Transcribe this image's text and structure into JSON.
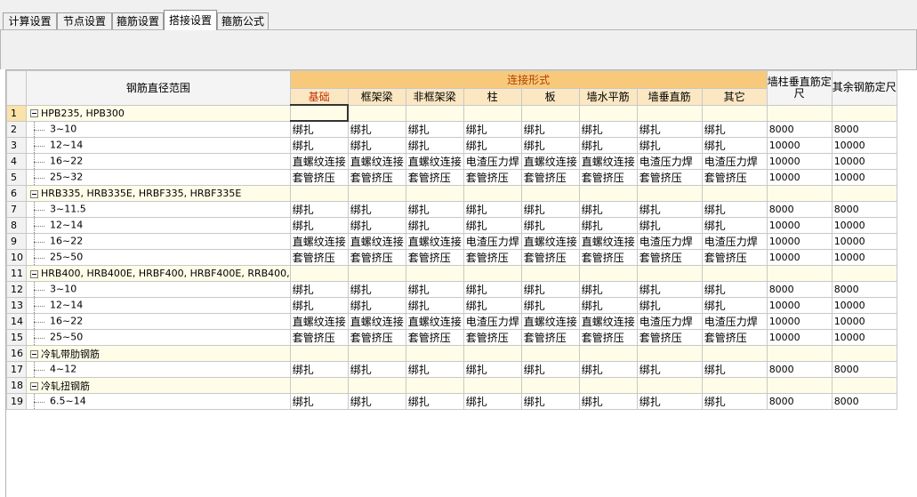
{
  "tabs": [
    {
      "label": "计算设置",
      "active": false
    },
    {
      "label": "节点设置",
      "active": false
    },
    {
      "label": "箍筋设置",
      "active": false
    },
    {
      "label": "搭接设置",
      "active": true
    },
    {
      "label": "箍筋公式",
      "active": false
    }
  ],
  "grid": {
    "header": {
      "diameter_range": "钢筋直径范围",
      "connection_group": "连接形式",
      "connection_columns": [
        "基础",
        "框架梁",
        "非框架梁",
        "柱",
        "板",
        "墙水平筋",
        "墙垂直筋",
        "其它"
      ],
      "wall_col": "墙柱垂直筋定尺",
      "other_col": "其余钢筋定尺"
    },
    "rows": [
      {
        "num": "1",
        "type": "group",
        "name": "HPB235, HPB300",
        "cells": [
          "",
          "",
          "",
          "",
          "",
          "",
          "",
          ""
        ],
        "wall": "",
        "other": ""
      },
      {
        "num": "2",
        "type": "child",
        "name": "3~10",
        "cells": [
          "绑扎",
          "绑扎",
          "绑扎",
          "绑扎",
          "绑扎",
          "绑扎",
          "绑扎",
          "绑扎"
        ],
        "wall": "8000",
        "other": "8000"
      },
      {
        "num": "3",
        "type": "child",
        "name": "12~14",
        "cells": [
          "绑扎",
          "绑扎",
          "绑扎",
          "绑扎",
          "绑扎",
          "绑扎",
          "绑扎",
          "绑扎"
        ],
        "wall": "10000",
        "other": "10000"
      },
      {
        "num": "4",
        "type": "child",
        "name": "16~22",
        "cells": [
          "直螺纹连接",
          "直螺纹连接",
          "直螺纹连接",
          "电渣压力焊",
          "直螺纹连接",
          "直螺纹连接",
          "电渣压力焊",
          "电渣压力焊"
        ],
        "wall": "10000",
        "other": "10000"
      },
      {
        "num": "5",
        "type": "child",
        "name": "25~32",
        "cells": [
          "套管挤压",
          "套管挤压",
          "套管挤压",
          "套管挤压",
          "套管挤压",
          "套管挤压",
          "套管挤压",
          "套管挤压"
        ],
        "wall": "10000",
        "other": "10000"
      },
      {
        "num": "6",
        "type": "group",
        "name": "HRB335, HRB335E, HRBF335, HRBF335E",
        "cells": [
          "",
          "",
          "",
          "",
          "",
          "",
          "",
          ""
        ],
        "wall": "",
        "other": ""
      },
      {
        "num": "7",
        "type": "child",
        "name": "3~11.5",
        "cells": [
          "绑扎",
          "绑扎",
          "绑扎",
          "绑扎",
          "绑扎",
          "绑扎",
          "绑扎",
          "绑扎"
        ],
        "wall": "8000",
        "other": "8000"
      },
      {
        "num": "8",
        "type": "child",
        "name": "12~14",
        "cells": [
          "绑扎",
          "绑扎",
          "绑扎",
          "绑扎",
          "绑扎",
          "绑扎",
          "绑扎",
          "绑扎"
        ],
        "wall": "10000",
        "other": "10000"
      },
      {
        "num": "9",
        "type": "child",
        "name": "16~22",
        "cells": [
          "直螺纹连接",
          "直螺纹连接",
          "直螺纹连接",
          "电渣压力焊",
          "直螺纹连接",
          "直螺纹连接",
          "电渣压力焊",
          "电渣压力焊"
        ],
        "wall": "10000",
        "other": "10000"
      },
      {
        "num": "10",
        "type": "child",
        "name": "25~50",
        "cells": [
          "套管挤压",
          "套管挤压",
          "套管挤压",
          "套管挤压",
          "套管挤压",
          "套管挤压",
          "套管挤压",
          "套管挤压"
        ],
        "wall": "10000",
        "other": "10000"
      },
      {
        "num": "11",
        "type": "group",
        "name": "HRB400, HRB400E, HRBF400, HRBF400E, RRB400,",
        "cells": [
          "",
          "",
          "",
          "",
          "",
          "",
          "",
          ""
        ],
        "wall": "",
        "other": ""
      },
      {
        "num": "12",
        "type": "child",
        "name": "3~10",
        "cells": [
          "绑扎",
          "绑扎",
          "绑扎",
          "绑扎",
          "绑扎",
          "绑扎",
          "绑扎",
          "绑扎"
        ],
        "wall": "8000",
        "other": "8000"
      },
      {
        "num": "13",
        "type": "child",
        "name": "12~14",
        "cells": [
          "绑扎",
          "绑扎",
          "绑扎",
          "绑扎",
          "绑扎",
          "绑扎",
          "绑扎",
          "绑扎"
        ],
        "wall": "10000",
        "other": "10000"
      },
      {
        "num": "14",
        "type": "child",
        "name": "16~22",
        "cells": [
          "直螺纹连接",
          "直螺纹连接",
          "直螺纹连接",
          "电渣压力焊",
          "直螺纹连接",
          "直螺纹连接",
          "电渣压力焊",
          "电渣压力焊"
        ],
        "wall": "10000",
        "other": "10000"
      },
      {
        "num": "15",
        "type": "child",
        "name": "25~50",
        "cells": [
          "套管挤压",
          "套管挤压",
          "套管挤压",
          "套管挤压",
          "套管挤压",
          "套管挤压",
          "套管挤压",
          "套管挤压"
        ],
        "wall": "10000",
        "other": "10000"
      },
      {
        "num": "16",
        "type": "group",
        "name": "冷轧带肋钢筋",
        "cells": [
          "",
          "",
          "",
          "",
          "",
          "",
          "",
          ""
        ],
        "wall": "",
        "other": ""
      },
      {
        "num": "17",
        "type": "child",
        "name": "4~12",
        "cells": [
          "绑扎",
          "绑扎",
          "绑扎",
          "绑扎",
          "绑扎",
          "绑扎",
          "绑扎",
          "绑扎"
        ],
        "wall": "8000",
        "other": "8000"
      },
      {
        "num": "18",
        "type": "group",
        "name": "冷轧扭钢筋",
        "cells": [
          "",
          "",
          "",
          "",
          "",
          "",
          "",
          ""
        ],
        "wall": "",
        "other": ""
      },
      {
        "num": "19",
        "type": "child",
        "name": "6.5~14",
        "cells": [
          "绑扎",
          "绑扎",
          "绑扎",
          "绑扎",
          "绑扎",
          "绑扎",
          "绑扎",
          "绑扎"
        ],
        "wall": "8000",
        "other": "8000"
      }
    ]
  },
  "colors": {
    "header_group_bg": "#f8c97a",
    "header_group_text": "#b04000",
    "header_sub_bg": "#fbe7c2",
    "group_row_bg": "#fffde8",
    "selected_rownum_bg": "#fbe2a8"
  }
}
